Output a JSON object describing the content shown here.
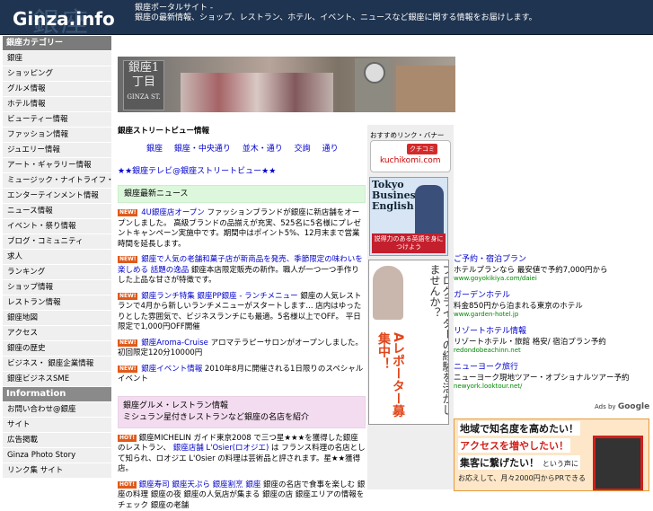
{
  "header": {
    "logo_text": "Ginza.info",
    "logo_kanji": "銀座",
    "tagline_line1": "銀座ポータルサイト -",
    "tagline_line2": "銀座の最新情報、ショップ、レストラン、ホテル、イベント、ニュースなど銀座に関する情報をお届けします。"
  },
  "nav": {
    "section1_title": "銀座カテゴリー",
    "items": [
      "銀座",
      "ショッピング",
      "グルメ情報",
      "ホテル情報",
      "ビューティー情報",
      "ファッション情報",
      "ジュエリー情報",
      "アート・ギャラリー情報",
      "ミュージック・ナイトライフ・DJ",
      "エンターテインメント情報",
      "ニュース情報",
      "イベント・祭り情報",
      "ブログ・コミュニティ",
      "求人",
      "ランキング",
      "ショップ情報",
      "レストラン情報",
      "銀座地図",
      "アクセス",
      "銀座の歴史",
      "ビジネス・ 銀座企業情報",
      "銀座ビジネスSME"
    ],
    "section2_title": "Information",
    "info_items": [
      "お問い合わせ@銀座",
      "サイト",
      "広告掲載",
      "Ginza Photo Story",
      "リンク集 サイト"
    ]
  },
  "banner": {
    "sign_text": "銀座1丁目",
    "sign_sub": "GINZA ST."
  },
  "main": {
    "section_title": "銀座ストリートビュー情報",
    "links": [
      "銀座",
      "銀座・中央通り",
      "並木・通り",
      "交詢",
      "通り"
    ],
    "tv_link": "★★銀座テレビ@銀座ストリートビュー★★",
    "news_title": "銀座最新ニュース",
    "news": [
      {
        "badge": "NEW!",
        "link": "4U銀座店オープン",
        "text": "ファッションブランドが銀座に新店舗をオープンしました。 高級ブランドの品揃えが充実、525名に5名様にプレゼントキャンペーン実施中です。期間中はポイント5%、12月末まで営業時間を延長します。"
      },
      {
        "badge": "NEW!",
        "link": "銀座で人気の老舗和菓子店が新商品を発売、季節限定の味わいを楽しめる 話題の逸品",
        "text": "銀座本店限定販売の新作。職人が一つ一つ手作りした上品な甘さが特徴です。"
      },
      {
        "badge": "NEW!",
        "link": "銀座ランチ特集 銀座PP銀座 - ランチメニュー",
        "text": "銀座の人気レストランで4月から新しいランチメニューがスタートします... 店内はゆったりとした雰囲気で、ビジネスランチにも最適。5名様以上でOFF。 平日限定で1,000円OFF開催"
      },
      {
        "badge": "NEW!",
        "link": "銀座Aroma-Cruise",
        "text": "アロマテラピーサロンがオープンしました。初回限定120分10000円"
      },
      {
        "badge": "NEW!",
        "link": "銀座イベント情報",
        "text": "2010年8月に開催される1日限りのスペシャルイベント"
      }
    ],
    "pink_line1": "銀座グルメ・レストラン情報",
    "pink_line2": "ミシュラン星付きレストランなど銀座の名店を紹介",
    "hot1_badge": "HOT!",
    "hot1_text": "銀座MICHELIN ガイド東京2008 で三つ星★★★を獲得した銀座のレストラン、",
    "hot1_link1": "銀座店舗",
    "hot1_link2": "L'Osier(ロオジエ)",
    "hot1_text2": "は フランス料理の名店として知られ、ロオジエ L'Osier の料理は芸術品と評されます。星★★獲得店。",
    "hot2_badge": "HOT!",
    "hot2_links": [
      "銀座寿司",
      "銀座天ぷら",
      "銀座割烹",
      "銀座"
    ],
    "hot2_text": "銀座の名店で食事を楽しむ 銀座の料理 銀座の夜 銀座の人気店が集まる 銀座の店 銀座エリアの情報をチェック 銀座の老舗"
  },
  "side": {
    "title": "おすすめリンク・バナー",
    "kuchikomi_label": "クチコミ",
    "kuchikomi_url": "kuchikomi.com",
    "tbe_title": "Tokyo Business English",
    "tbe_slogan": "説得力のある英語を身につけよう",
    "blogger_v1": "ブログライターの経験を活かしませんか？",
    "blogger_v2": "Aレポーター募集中！"
  },
  "ads": {
    "items": [
      {
        "title": "ご予約・宿泊プラン",
        "desc": "ホテルプランなら 最安値で予約7,000円から",
        "url": "www.goyokikiya.com/daiei"
      },
      {
        "title": "ガーデンホテル",
        "desc": "料金850円から泊まれる東京のホテル",
        "url": "www.garden-hotel.jp"
      },
      {
        "title": "リゾートホテル情報",
        "desc": "リゾートホテル・旅館 格安/ 宿泊プラン予約",
        "url": "redondobeachinn.net"
      },
      {
        "title": "ニューヨーク旅行",
        "desc": "ニューヨーク現地ツアー・オプショナルツアー予約",
        "url": "newyork.looktour.net/"
      }
    ],
    "adsby_label": "Ads by",
    "adsby_brand": "Google"
  },
  "promo": {
    "line1": "地域で知名度を高めたい！",
    "line2": "アクセスを増やしたい！",
    "line3": "集客に繋げたい！",
    "line3_small": "という声に",
    "line4": "お応えして、月々2000円からPRできる"
  }
}
